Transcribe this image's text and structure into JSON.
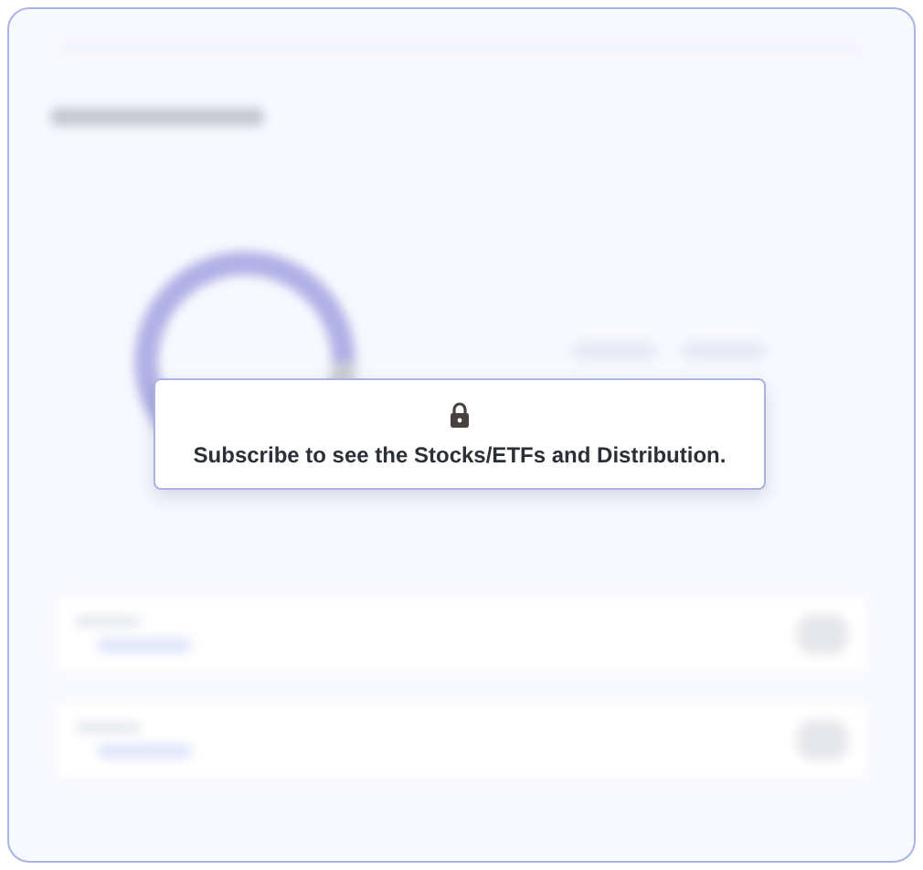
{
  "notice": {
    "message": "Subscribe to see the Stocks/ETFs and Distribution."
  },
  "blurred_legend": [
    {
      "kind": "pill"
    },
    {
      "kind": "pill"
    }
  ],
  "blurred_rows": [
    {
      "kind": "row"
    },
    {
      "kind": "row"
    }
  ]
}
